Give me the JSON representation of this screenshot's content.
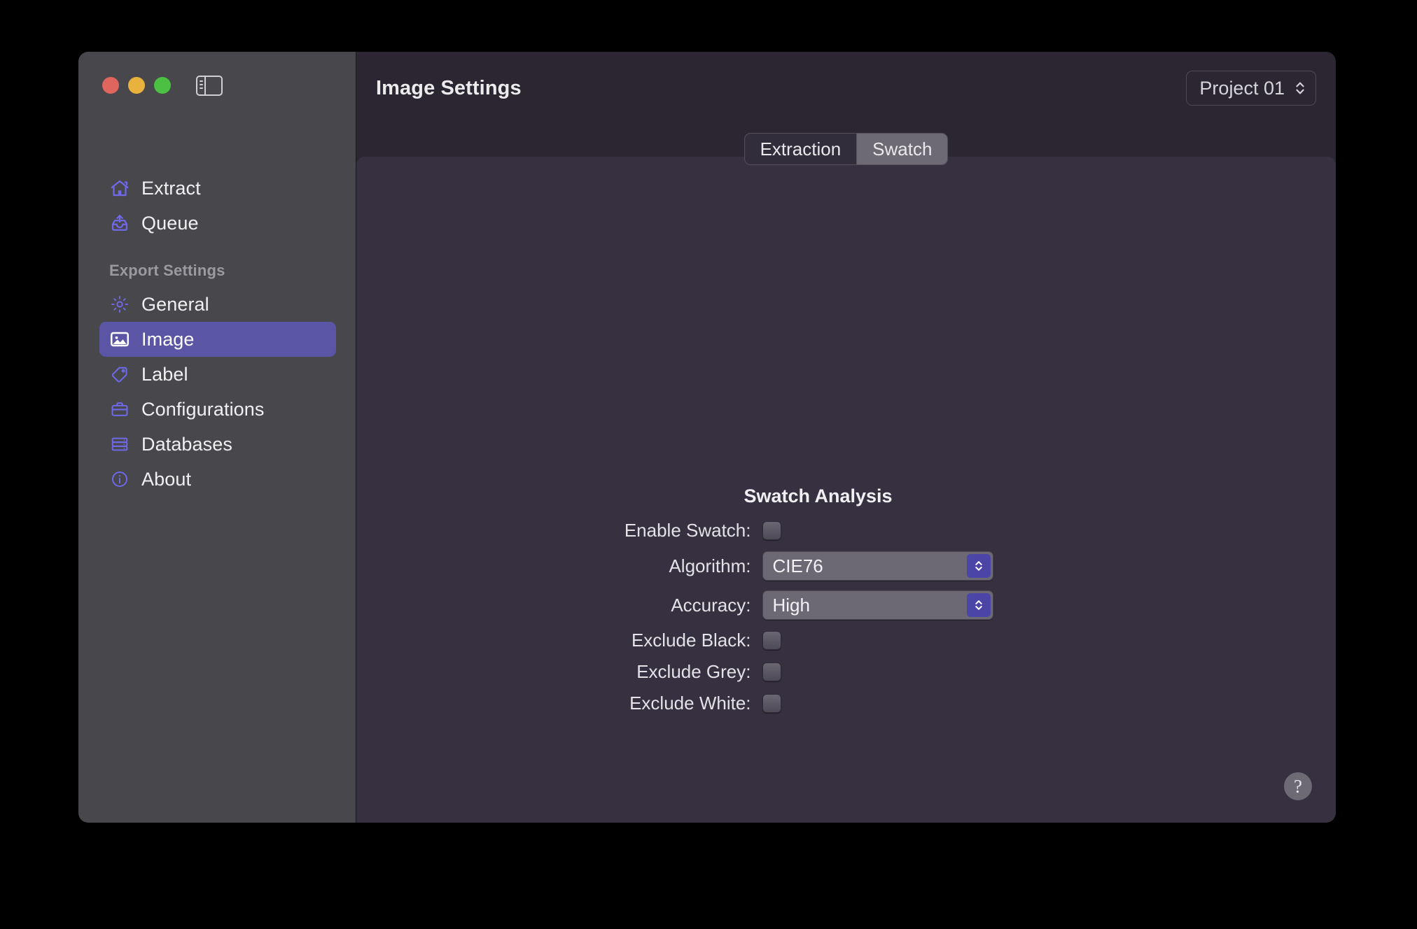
{
  "window": {
    "traffic_lights": [
      {
        "name": "close",
        "color": "#e0655e"
      },
      {
        "name": "minimize",
        "color": "#e9b23e"
      },
      {
        "name": "zoom",
        "color": "#4cc043"
      }
    ]
  },
  "sidebar": {
    "toggle_icon": "sidebar-toggle-icon",
    "top_items": [
      {
        "label": "Extract",
        "icon": "house-icon",
        "selected": false
      },
      {
        "label": "Queue",
        "icon": "tray-upload-icon",
        "selected": false
      }
    ],
    "section_header": "Export Settings",
    "settings_items": [
      {
        "label": "General",
        "icon": "gear-icon",
        "selected": false
      },
      {
        "label": "Image",
        "icon": "photo-icon",
        "selected": true
      },
      {
        "label": "Label",
        "icon": "tag-icon",
        "selected": false
      },
      {
        "label": "Configurations",
        "icon": "briefcase-icon",
        "selected": false
      },
      {
        "label": "Databases",
        "icon": "server-rack-icon",
        "selected": false
      },
      {
        "label": "About",
        "icon": "info-circle-icon",
        "selected": false
      }
    ],
    "accent_color": "#6f68e8",
    "selected_row_color": "#5b55a6"
  },
  "toolbar": {
    "title": "Image Settings",
    "project_picker": {
      "value": "Project 01",
      "icon": "chevron-up-down-icon"
    }
  },
  "tabs": [
    {
      "label": "Extraction",
      "active": false
    },
    {
      "label": "Swatch",
      "active": true
    }
  ],
  "main": {
    "group_title": "Swatch Analysis",
    "rows": [
      {
        "label": "Enable Swatch:",
        "type": "checkbox",
        "checked": false
      },
      {
        "label": "Algorithm:",
        "type": "select",
        "value": "CIE76"
      },
      {
        "label": "Accuracy:",
        "type": "select",
        "value": "High"
      },
      {
        "label": "Exclude Black:",
        "type": "checkbox",
        "checked": false
      },
      {
        "label": "Exclude Grey:",
        "type": "checkbox",
        "checked": false
      },
      {
        "label": "Exclude White:",
        "type": "checkbox",
        "checked": false
      }
    ],
    "help_label": "?",
    "select_arrow_color": "#4b45a8"
  }
}
